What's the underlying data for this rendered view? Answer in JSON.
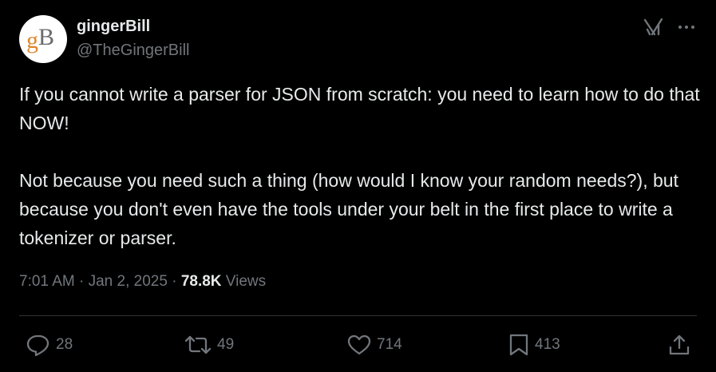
{
  "author": {
    "display_name": "gingerBill",
    "handle": "@TheGingerBill",
    "avatar_text": "gB"
  },
  "header": {
    "grok_icon": "grok-icon",
    "more_icon": "more-dots-icon"
  },
  "tweet": {
    "paragraphs": [
      "If you cannot write a parser for JSON from scratch: you need to learn how to do that NOW!",
      "Not because you need such a thing (how would I know your random needs?), but because you don't even have the tools under your belt in the first place to write a tokenizer or parser."
    ]
  },
  "meta": {
    "time": "7:01 AM",
    "separator": "·",
    "date": "Jan 2, 2025",
    "views_count": "78.8K",
    "views_label": "Views"
  },
  "actions": {
    "replies": "28",
    "reposts": "49",
    "likes": "714",
    "bookmarks": "413"
  },
  "colors": {
    "background": "#000000",
    "text_primary": "#e7e9ea",
    "text_secondary": "#71767b",
    "divider": "#2f3336",
    "avatar_orange": "#e0862b",
    "avatar_gray": "#6b6b6b"
  }
}
